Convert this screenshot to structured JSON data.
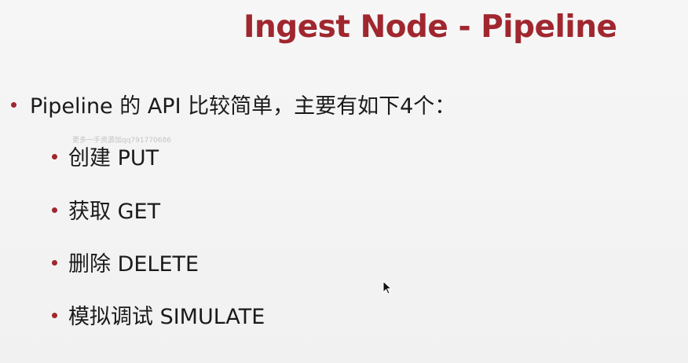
{
  "slide": {
    "title": "Ingest Node - Pipeline",
    "main_bullet": "Pipeline 的 API 比较简单，主要有如下4个：",
    "watermark": "更多一手资源加qq791770686",
    "sub_bullets": [
      "创建 PUT",
      "获取 GET",
      "删除 DELETE",
      "模拟调试 SIMULATE"
    ]
  },
  "colors": {
    "accent": "#a0272f",
    "text": "#1a1a1a",
    "background": "#f3f3f3"
  },
  "icons": {
    "cursor": "mouse-pointer-icon",
    "bullet": "bullet-dot-icon"
  }
}
